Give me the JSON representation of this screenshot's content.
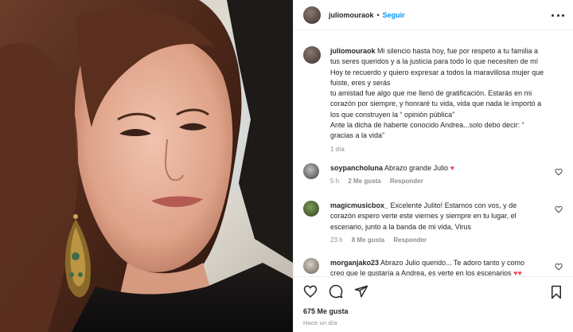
{
  "post": {
    "username": "juliomouraok",
    "separator": "•",
    "follow_label": "Seguir",
    "caption_username": "juliomouraok",
    "caption_lines": [
      "Mi silencio hasta hoy, fue por respeto a tu familia a",
      "tus seres queridos y a la justicia para todo lo que necesiten de mí",
      "Hoy te recuerdo y quiero expresar a todos la maravillosa mujer que",
      "fuiste, eres y serás",
      "tu amistad fue algo que me llenó de gratificación. Estarás en mi",
      "corazón por siempre, y honraré tu vida, vida que nada le importó a",
      "los que construyen la “ opinión pública”",
      "Ante la dicha de haberte conocido Andrea...solo debo decir: “",
      "gracias a la vida”"
    ],
    "caption_time": "1 día"
  },
  "comments": [
    {
      "username": "soypancholuna",
      "text": "Abrazo grande Julio",
      "emoji": "♥",
      "time": "5 h",
      "likes": "2 Me gusta",
      "reply": "Responder"
    },
    {
      "username": "magicmusicbox_",
      "lines": [
        "Excelente Julito! Estamos con vos, y de",
        "corazón espero verte este viernes y siempre en tu lugar, el",
        "escenario, junto a la banda de mi vida, Virus"
      ],
      "time": "23 h",
      "likes": "8 Me gusta",
      "reply": "Responder"
    },
    {
      "username": "morganjako23",
      "lines": [
        "Abrazo Julio querido... Te adoro tanto y como",
        "creo que le gustaría a Andrea, es verte en los escenarios"
      ],
      "emoji": "♥♥"
    }
  ],
  "footer": {
    "likes": "675 Me gusta",
    "posted": "Hace un día"
  },
  "icons": {
    "like": "heart-icon",
    "comment": "comment-icon",
    "share": "share-icon",
    "save": "bookmark-icon",
    "more": "more-options-icon"
  },
  "colors": {
    "link_blue": "#0095f6",
    "heart_red": "#ed4956",
    "muted": "#8e8e8e"
  }
}
